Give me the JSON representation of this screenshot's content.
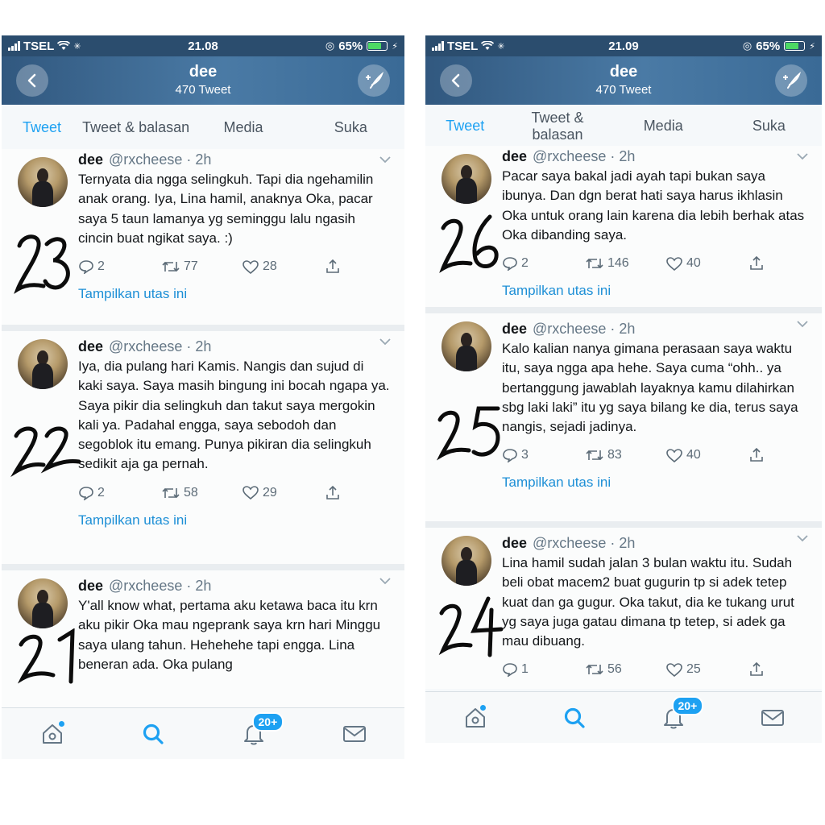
{
  "screens": [
    {
      "status": {
        "carrier": "TSEL",
        "time": "21.08",
        "battery": "65%",
        "battery_level": 0.65
      },
      "header": {
        "name": "dee",
        "tweet_count": "470 Tweet"
      },
      "tabs": [
        "Tweet",
        "Tweet & balasan",
        "Media",
        "Suka"
      ],
      "tweets": [
        {
          "name": "dee",
          "handle": "@rxcheese · 2h",
          "text": "Ternyata dia ngga selingkuh. Tapi dia ngehamilin anak orang. Iya, Lina hamil, anaknya Oka, pacar saya 5 taun lamanya yg seminggu lalu ngasih cincin buat ngikat saya. :)",
          "replies": "2",
          "retweets": "77",
          "likes": "28",
          "thread": "Tampilkan utas ini",
          "hand_number": "23"
        },
        {
          "name": "dee",
          "handle": "@rxcheese · 2h",
          "text": "Iya, dia pulang hari Kamis. Nangis dan sujud di kaki saya. Saya masih bingung ini bocah ngapa ya. Saya pikir dia selingkuh dan takut saya mergokin kali ya. Padahal engga, saya sebodoh dan segoblok itu emang. Punya pikiran dia selingkuh sedikit aja ga pernah.",
          "replies": "2",
          "retweets": "58",
          "likes": "29",
          "thread": "Tampilkan utas ini",
          "hand_number": "22"
        },
        {
          "name": "dee",
          "handle": "@rxcheese · 2h",
          "text": "Y'all know what, pertama aku ketawa baca itu krn aku pikir Oka mau ngeprank saya krn hari Minggu saya ulang tahun. Hehehehe tapi engga. Lina beneran ada. Oka pulang",
          "hand_number": "21"
        }
      ],
      "badge": "20+"
    },
    {
      "status": {
        "carrier": "TSEL",
        "time": "21.09",
        "battery": "65%",
        "battery_level": 0.65
      },
      "header": {
        "name": "dee",
        "tweet_count": "470 Tweet"
      },
      "tabs": [
        "Tweet",
        "Tweet & balasan",
        "Media",
        "Suka"
      ],
      "tweets": [
        {
          "name": "dee",
          "handle": "@rxcheese · 2h",
          "text": "Pacar saya bakal jadi ayah tapi bukan saya ibunya. Dan dgn berat hati saya harus ikhlasin Oka untuk orang lain karena dia lebih berhak atas Oka dibanding saya.",
          "replies": "2",
          "retweets": "146",
          "likes": "40",
          "thread": "Tampilkan utas ini",
          "hand_number": "26"
        },
        {
          "name": "dee",
          "handle": "@rxcheese · 2h",
          "text": "Kalo kalian nanya gimana perasaan saya waktu itu, saya ngga apa hehe. Saya cuma “ohh.. ya bertanggung jawablah layaknya kamu dilahirkan sbg laki laki” itu yg saya bilang ke dia, terus saya nangis, sejadi jadinya.",
          "replies": "3",
          "retweets": "83",
          "likes": "40",
          "thread": "Tampilkan utas ini",
          "hand_number": "25"
        },
        {
          "name": "dee",
          "handle": "@rxcheese · 2h",
          "text": "Lina hamil sudah jalan 3 bulan waktu itu. Sudah beli obat macem2 buat gugurin tp si adek tetep kuat dan ga gugur. Oka takut, dia ke tukang urut yg saya juga gatau dimana tp tetep, si adek ga mau dibuang.",
          "replies": "1",
          "retweets": "56",
          "likes": "25",
          "hand_number": "24"
        }
      ],
      "badge": "20+"
    }
  ],
  "colors": {
    "accent": "#1da1f2",
    "header": "#3a6a96",
    "text": "#14171a",
    "muted": "#657786"
  },
  "icons": [
    "back-arrow-icon",
    "compose-tweet-icon",
    "reply-icon",
    "retweet-icon",
    "like-icon",
    "share-icon",
    "chevron-down-icon",
    "home-icon",
    "search-icon",
    "notifications-icon",
    "messages-icon"
  ]
}
